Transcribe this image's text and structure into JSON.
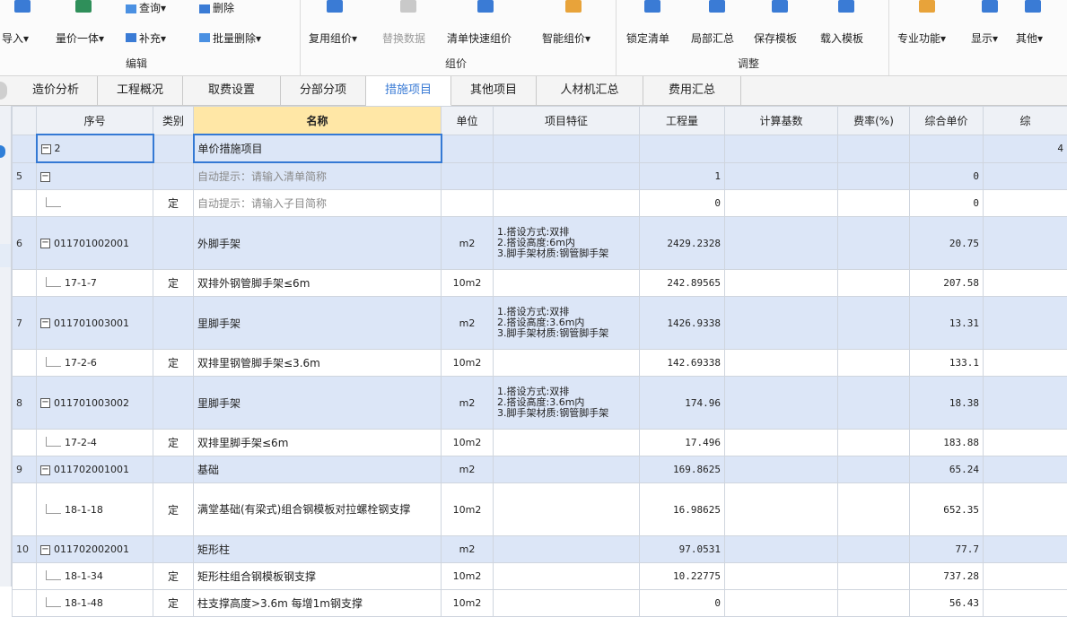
{
  "ribbon": {
    "row_top": {
      "query_label": "查询",
      "delete_label": "删除"
    },
    "buttons": [
      {
        "label": "导入",
        "dropdown": true
      },
      {
        "label": "量价一体",
        "dropdown": true
      },
      {
        "label": "补充",
        "dropdown": true
      },
      {
        "label": "批量删除",
        "dropdown": true
      },
      {
        "label": "复用组价",
        "dropdown": true
      },
      {
        "label": "替换数据"
      },
      {
        "label": "清单快速组价"
      },
      {
        "label": "智能组价",
        "dropdown": true
      },
      {
        "label": "锁定清单"
      },
      {
        "label": "局部汇总"
      },
      {
        "label": "保存模板"
      },
      {
        "label": "载入模板"
      },
      {
        "label": "专业功能",
        "dropdown": true
      },
      {
        "label": "显示",
        "dropdown": true
      },
      {
        "label": "其他",
        "dropdown": true
      }
    ],
    "groups": {
      "edit": "编辑",
      "price": "组价",
      "adjust": "调整"
    },
    "dropdown_arrow": "▾"
  },
  "tabs": [
    {
      "label": "造价分析",
      "active": false
    },
    {
      "label": "工程概况",
      "active": false
    },
    {
      "label": "取费设置",
      "active": false
    },
    {
      "label": "分部分项",
      "active": false
    },
    {
      "label": "措施项目",
      "active": true
    },
    {
      "label": "其他项目",
      "active": false
    },
    {
      "label": "人材机汇总",
      "active": false
    },
    {
      "label": "费用汇总",
      "active": false
    }
  ],
  "columns": {
    "seq": "序号",
    "type": "类别",
    "name": "名称",
    "unit": "单位",
    "feature": "项目特征",
    "qty": "工程量",
    "base": "计算基数",
    "rate": "费率(%)",
    "price": "综合单价",
    "extra": "综"
  },
  "rows": [
    {
      "kind": "group",
      "no": "",
      "code": "2",
      "type": "",
      "name": "单价措施项目",
      "unit": "",
      "feature": "",
      "qty": "",
      "price": "",
      "extra": "4"
    },
    {
      "kind": "list",
      "no": "5",
      "code": "",
      "type": "",
      "name": "自动提示：请输入清单简称",
      "unit": "",
      "feature": "",
      "qty": "1",
      "price": "0",
      "hint": true
    },
    {
      "kind": "sub",
      "no": "",
      "code": "",
      "type": "定",
      "name": "自动提示：请输入子目简称",
      "unit": "",
      "feature": "",
      "qty": "0",
      "price": "0",
      "hint": true
    },
    {
      "kind": "list",
      "no": "6",
      "code": "011701002001",
      "type": "",
      "name": "外脚手架",
      "unit": "m2",
      "feature": "1.搭设方式:双排\n2.搭设高度:6m内\n3.脚手架材质:钢管脚手架",
      "qty": "2429.2328",
      "price": "20.75",
      "tall": true
    },
    {
      "kind": "sub",
      "no": "",
      "code": "17-1-7",
      "type": "定",
      "name": "双排外钢管脚手架≤6m",
      "unit": "10m2",
      "feature": "",
      "qty": "242.89565",
      "price": "207.58"
    },
    {
      "kind": "list",
      "no": "7",
      "code": "011701003001",
      "type": "",
      "name": "里脚手架",
      "unit": "m2",
      "feature": "1.搭设方式:双排\n2.搭设高度:3.6m内\n3.脚手架材质:钢管脚手架",
      "qty": "1426.9338",
      "price": "13.31",
      "tall": true
    },
    {
      "kind": "sub",
      "no": "",
      "code": "17-2-6",
      "type": "定",
      "name": "双排里钢管脚手架≤3.6m",
      "unit": "10m2",
      "feature": "",
      "qty": "142.69338",
      "price": "133.1"
    },
    {
      "kind": "list",
      "no": "8",
      "code": "011701003002",
      "type": "",
      "name": "里脚手架",
      "unit": "m2",
      "feature": "1.搭设方式:双排\n2.搭设高度:3.6m内\n3.脚手架材质:钢管脚手架",
      "qty": "174.96",
      "price": "18.38",
      "tall": true
    },
    {
      "kind": "sub",
      "no": "",
      "code": "17-2-4",
      "type": "定",
      "name": "双排里脚手架≤6m",
      "unit": "10m2",
      "feature": "",
      "qty": "17.496",
      "price": "183.88"
    },
    {
      "kind": "list",
      "no": "9",
      "code": "011702001001",
      "type": "",
      "name": "基础",
      "unit": "m2",
      "feature": "",
      "qty": "169.8625",
      "price": "65.24"
    },
    {
      "kind": "sub",
      "no": "",
      "code": "18-1-18",
      "type": "定",
      "name": "满堂基础(有梁式)组合钢模板对拉螺栓钢支撑",
      "unit": "10m2",
      "feature": "",
      "qty": "16.98625",
      "price": "652.35",
      "tall2": true
    },
    {
      "kind": "list",
      "no": "10",
      "code": "011702002001",
      "type": "",
      "name": "矩形柱",
      "unit": "m2",
      "feature": "",
      "qty": "97.0531",
      "price": "77.7"
    },
    {
      "kind": "sub",
      "no": "",
      "code": "18-1-34",
      "type": "定",
      "name": "矩形柱组合钢模板钢支撑",
      "unit": "10m2",
      "feature": "",
      "qty": "10.22775",
      "price": "737.28"
    },
    {
      "kind": "sub",
      "no": "",
      "code": "18-1-48",
      "type": "定",
      "name": "柱支撑高度>3.6m 每增1m钢支撑",
      "unit": "10m2",
      "feature": "",
      "qty": "0",
      "price": "56.43"
    }
  ],
  "colors": {
    "accent": "#3a7bd5",
    "list_row_bg": "#dce6f7",
    "name_header_bg": "#ffe7a6"
  }
}
